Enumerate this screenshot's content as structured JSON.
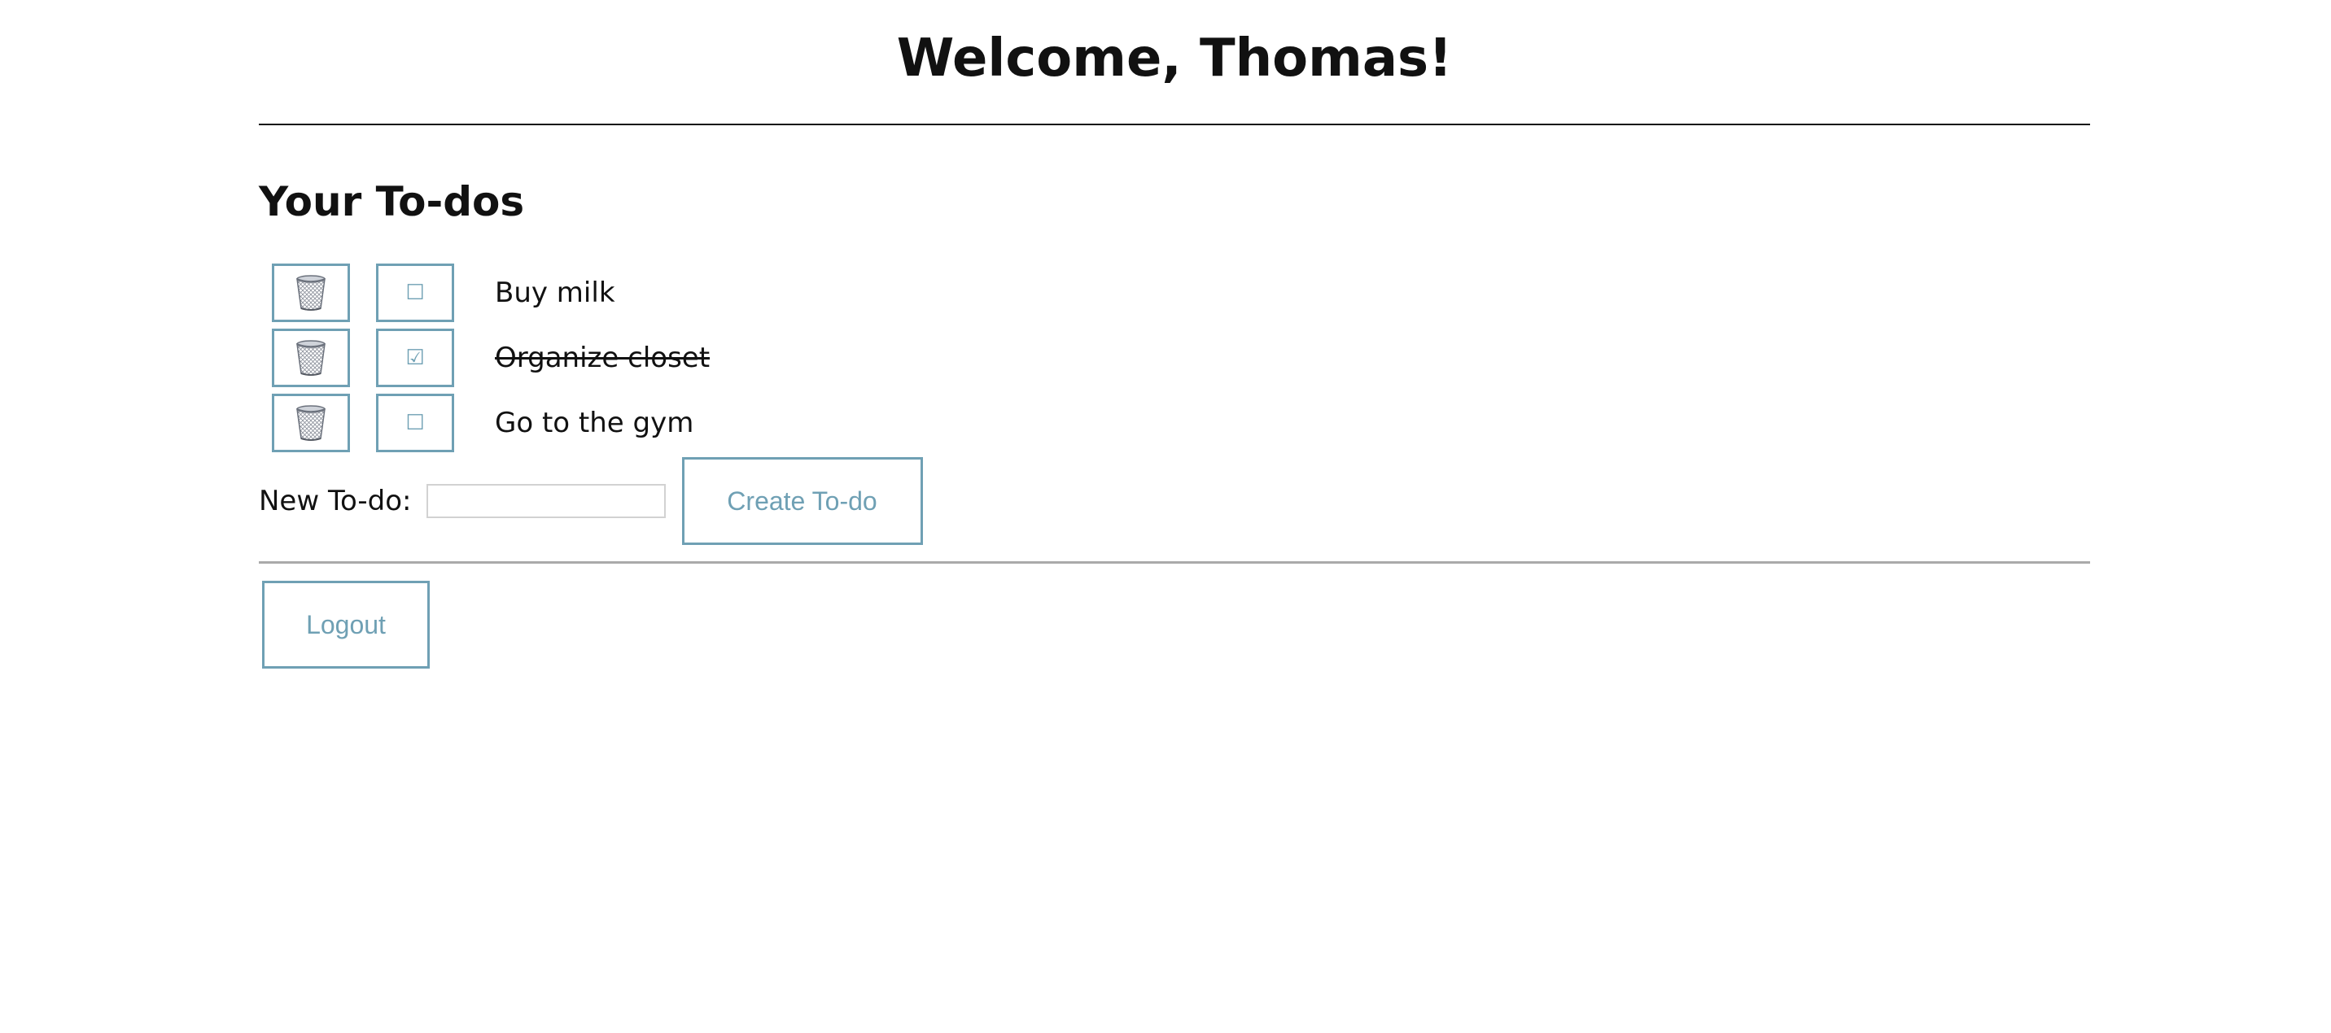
{
  "header": {
    "title": "Welcome, Thomas!"
  },
  "todos": {
    "heading": "Your To-dos",
    "items": [
      {
        "text": "Buy milk",
        "completed": false
      },
      {
        "text": "Organize closet",
        "completed": true
      },
      {
        "text": "Go to the gym",
        "completed": false
      }
    ]
  },
  "new_todo": {
    "label": "New To-do:",
    "value": "",
    "placeholder": "",
    "create_label": "Create To-do"
  },
  "logout": {
    "label": "Logout"
  },
  "icons": {
    "delete": "wastebasket-icon",
    "unchecked": "ballot-box-icon",
    "checked": "ballot-box-with-check-icon"
  },
  "colors": {
    "accent": "#6fa0b4",
    "text": "#111111"
  }
}
